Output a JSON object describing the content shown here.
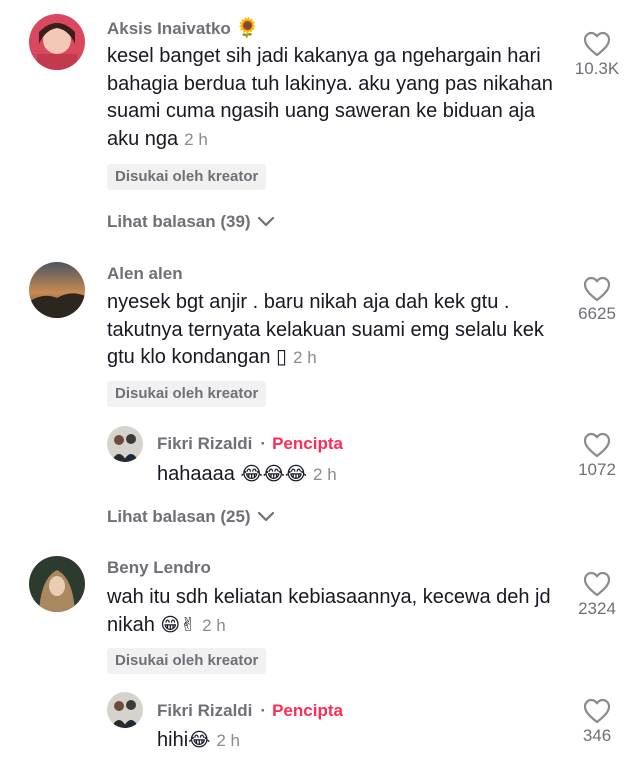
{
  "comments": [
    {
      "username": "Aksis Inaivatko",
      "username_emoji": "🌻",
      "text": "kesel banget sih jadi kakanya ga ngehargain hari bahagia berdua tuh lakinya. aku yang pas nikahan suami cuma ngasih uang saweran ke biduan aja aku nga",
      "time": "2 h",
      "badge": "Disukai oleh kreator",
      "likes": "10.3K",
      "replies_label": "Lihat balasan (39)"
    },
    {
      "username": "Alen alen",
      "text": "nyesek bgt anjir . baru nikah aja dah kek gtu . takutnya ternyata kelakuan suami emg selalu kek gtu klo kondangan ▯",
      "time": "2 h",
      "badge": "Disukai oleh kreator",
      "likes": "6625",
      "reply": {
        "username": "Fikri Rizaldi",
        "separator": "·",
        "creator_label": "Pencipta",
        "text": "hahaaaa",
        "emojis": "😂😂😂",
        "time": "2 h",
        "likes": "1072"
      },
      "replies_label": "Lihat balasan (25)"
    },
    {
      "username": "Beny Lendro",
      "text": "wah itu sdh keliatan kebiasaannya, kecewa deh jd nikah",
      "emojis": "😁✌",
      "time": "2 h",
      "badge": "Disukai oleh kreator",
      "likes": "2324",
      "reply": {
        "username": "Fikri Rizaldi",
        "separator": "·",
        "creator_label": "Pencipta",
        "text": "hihi",
        "emojis": "😂",
        "time": "2 h",
        "likes": "346"
      }
    }
  ],
  "colors": {
    "creator": "#fe2c55",
    "badge_bg": "#f1f1f2",
    "muted": "#8a8b91"
  },
  "icons": {
    "like": "heart-outline-icon",
    "expand": "chevron-down-icon"
  }
}
